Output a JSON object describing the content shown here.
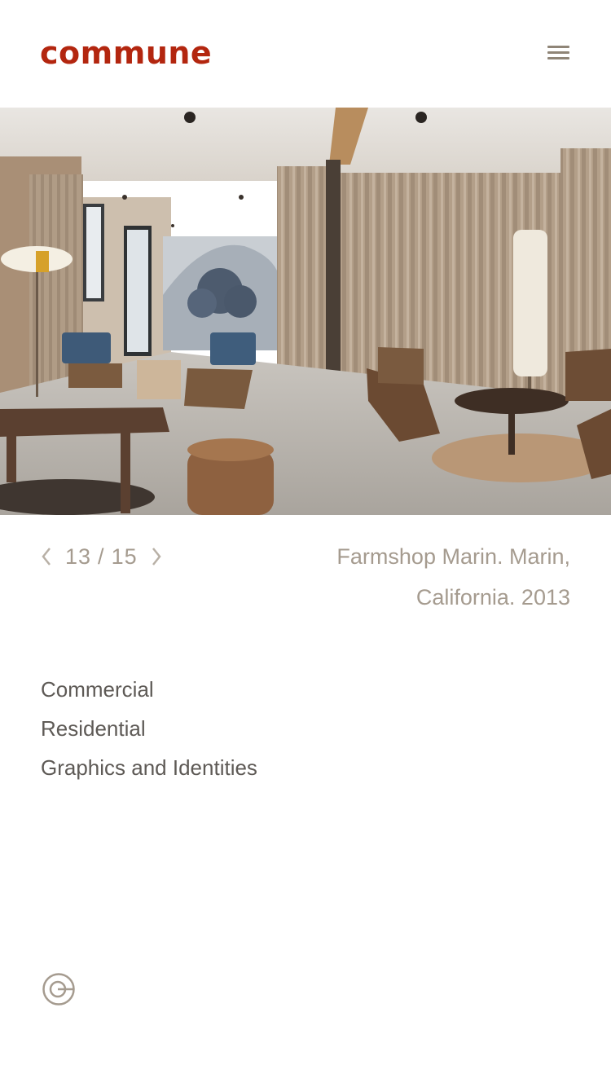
{
  "header": {
    "logo_text": "commune",
    "menu_icon": "hamburger-menu-icon",
    "logo_color": "#b3260f"
  },
  "hero": {
    "image_subject": "interior photo of a lounge room with curtains, wooden chairs and blue cushions"
  },
  "slider": {
    "current": "13",
    "separator": "/",
    "total": "15",
    "prev_icon": "chevron-left-icon",
    "next_icon": "chevron-right-icon",
    "caption_line1": "Farmshop Marin. Marin,",
    "caption_line2": "California. 2013"
  },
  "categories": [
    {
      "label": "Commercial"
    },
    {
      "label": "Residential"
    },
    {
      "label": "Graphics and Identities"
    }
  ],
  "footer": {
    "icon": "commune-circle-logo-icon"
  },
  "colors": {
    "accent": "#b3260f",
    "muted_text": "#a59b8f",
    "body_text": "#5e5a56",
    "icon_gray": "#8f8577"
  }
}
